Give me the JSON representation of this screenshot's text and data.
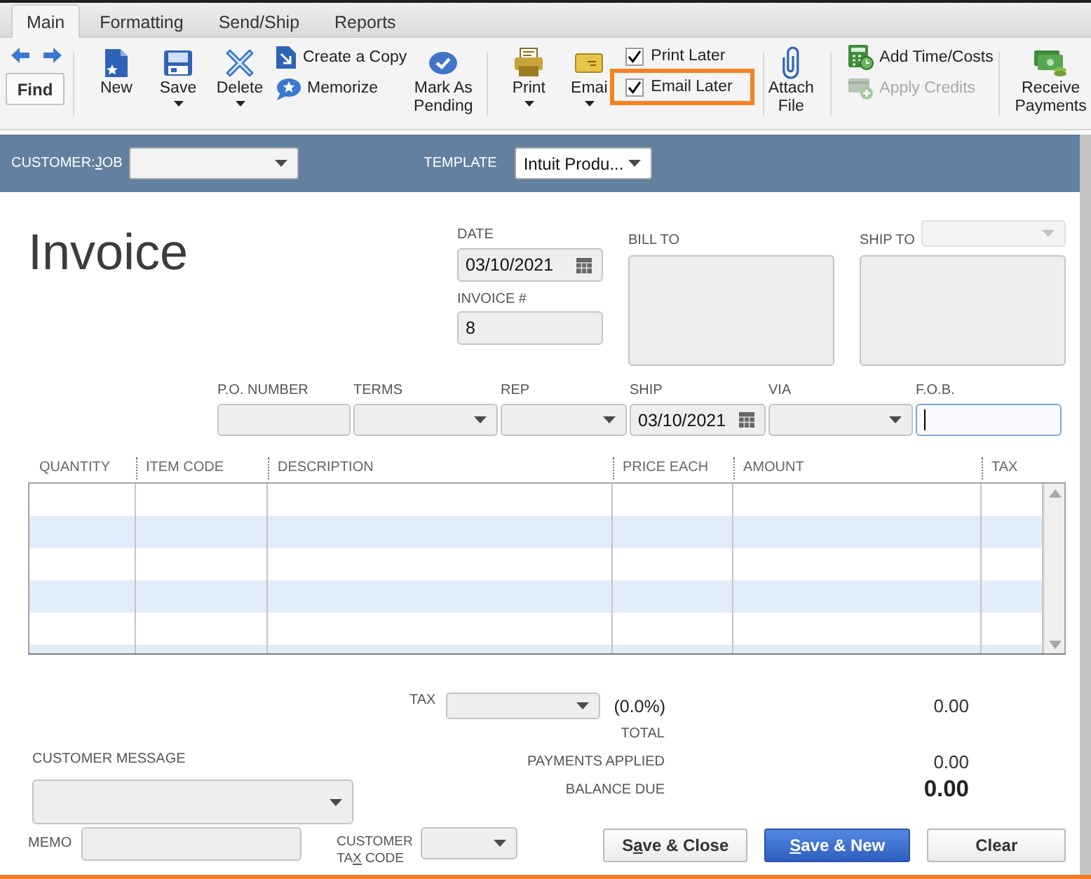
{
  "tabs": [
    {
      "label": "Main",
      "selected": true
    },
    {
      "label": "Formatting",
      "selected": false
    },
    {
      "label": "Send/Ship",
      "selected": false
    },
    {
      "label": "Reports",
      "selected": false
    }
  ],
  "toolbar": {
    "find": "Find",
    "new": {
      "label": "New",
      "has_menu": false
    },
    "save": {
      "label": "Save",
      "has_menu": true
    },
    "delete": {
      "label": "Delete",
      "has_menu": true
    },
    "create_copy": {
      "label": "Create a Copy",
      "disabled": false
    },
    "memorize": {
      "label": "Memorize",
      "disabled": false
    },
    "mark_as_pending": {
      "label": "Mark As Pending",
      "has_menu": false
    },
    "print": {
      "label": "Print",
      "has_menu": true
    },
    "email": {
      "label": "Emai",
      "has_menu": true
    },
    "print_later": {
      "label": "Print Later",
      "checked": true,
      "highlighted": false
    },
    "email_later": {
      "label": "Email Later",
      "checked": true,
      "highlighted": true
    },
    "attach_file": {
      "label": "Attach File",
      "has_menu": false
    },
    "add_time_costs": {
      "label": "Add Time/Costs",
      "disabled": false
    },
    "apply_credits": {
      "label": "Apply Credits",
      "disabled": true
    },
    "receive_payments": {
      "label": "Receive Payments",
      "has_menu": false
    }
  },
  "header": {
    "customer_job": {
      "label": "CUSTOMER:JOB"
    },
    "template": {
      "label": "TEMPLATE",
      "value": "Intuit Produ..."
    }
  },
  "form": {
    "title": "Invoice",
    "date": {
      "label": "DATE",
      "value": "03/10/2021"
    },
    "invoice_number": {
      "label": "INVOICE #",
      "value": "8"
    },
    "bill_to": {
      "label": "BILL TO"
    },
    "ship_to": {
      "label": "SHIP TO",
      "dropdown_disabled": true
    },
    "details": [
      {
        "kind": "text",
        "label": "P.O. NUMBER",
        "focused": false
      },
      {
        "kind": "select",
        "label": "TERMS",
        "focused": false
      },
      {
        "kind": "select",
        "label": "REP",
        "focused": false
      },
      {
        "kind": "date",
        "label": "SHIP",
        "value": "03/10/2021",
        "focused": false
      },
      {
        "kind": "select",
        "label": "VIA",
        "focused": false
      },
      {
        "kind": "text",
        "label": "F.O.B.",
        "focused": true
      }
    ]
  },
  "table": {
    "columns": [
      "QUANTITY",
      "ITEM CODE",
      "DESCRIPTION",
      "PRICE EACH",
      "AMOUNT",
      "TAX"
    ]
  },
  "totals": {
    "tax": {
      "label": "TAX",
      "rate": "(0.0%)",
      "amount": "0.00"
    },
    "total": {
      "label": "TOTAL"
    },
    "payments_applied": {
      "label": "PAYMENTS APPLIED",
      "amount": "0.00"
    },
    "balance_due": {
      "label": "BALANCE DUE",
      "amount": "0.00"
    }
  },
  "customer_message": {
    "label": "CUSTOMER MESSAGE"
  },
  "memo": {
    "label": "MEMO"
  },
  "customer_tax_code": {
    "label": "CUSTOMER TAX CODE"
  },
  "buttons": [
    {
      "label": "Save & Close",
      "primary": false
    },
    {
      "label": "Save & New",
      "primary": true
    },
    {
      "label": "Clear",
      "primary": false
    }
  ]
}
